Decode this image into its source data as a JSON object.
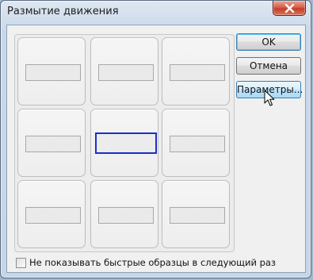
{
  "window": {
    "title": "Размытие движения"
  },
  "buttons": {
    "ok": "OK",
    "cancel": "Отмена",
    "parameters": "Параметры..."
  },
  "footer": {
    "checkbox_label": "Не показывать быстрые образцы в следующий раз",
    "checkbox_checked": false
  },
  "previews": {
    "count": 9,
    "selected_index": 4
  },
  "colors": {
    "selection_border": "#1b2fc8",
    "close_button": "#c33e27"
  },
  "icons": {
    "close": "close-icon",
    "cursor": "mouse-pointer-icon"
  }
}
